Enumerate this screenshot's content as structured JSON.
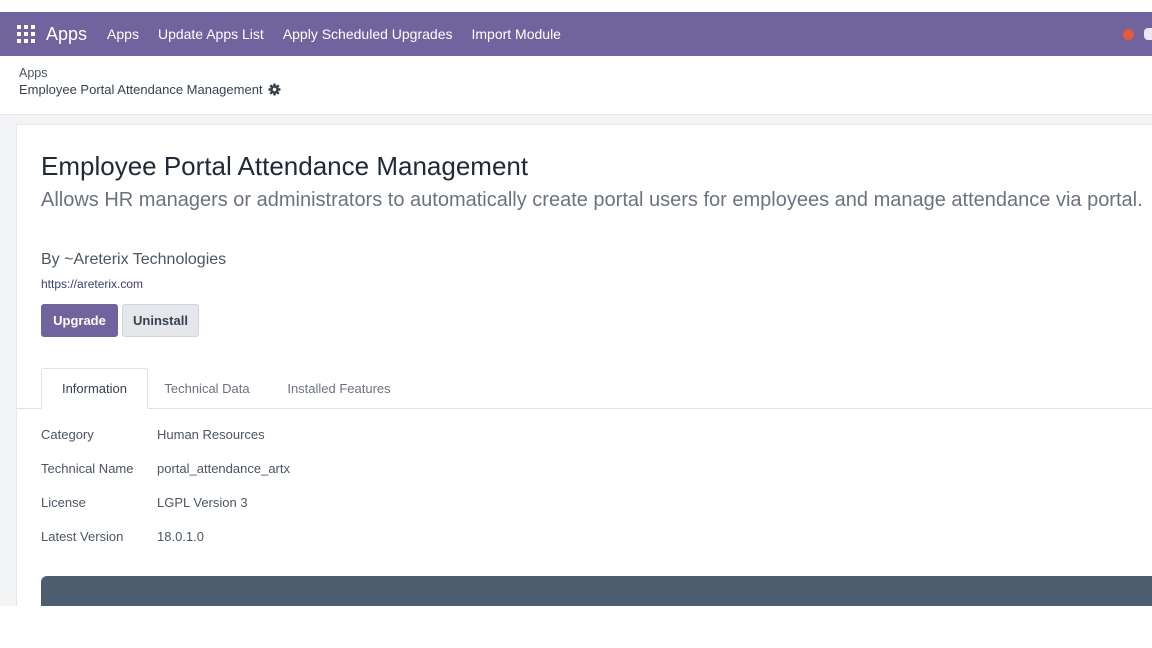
{
  "navbar": {
    "brand": "Apps",
    "menu": [
      "Apps",
      "Update Apps List",
      "Apply Scheduled Upgrades",
      "Import Module"
    ],
    "color": "#71639e",
    "icons": [
      "apps-grid-icon",
      "notification-dot-icon",
      "chat-icon"
    ]
  },
  "breadcrumb": {
    "parent": "Apps",
    "current": "Employee Portal Attendance Management",
    "icon": "gear-icon"
  },
  "module": {
    "title": "Employee Portal Attendance Management",
    "summary": "Allows HR managers or administrators to automatically create portal users for employees and manage attendance via portal.",
    "author": "By ~Areterix Technologies",
    "website": "https://areterix.com"
  },
  "buttons": {
    "upgrade": "Upgrade",
    "uninstall": "Uninstall"
  },
  "tabs": [
    {
      "label": "Information",
      "active": true
    },
    {
      "label": "Technical Data",
      "active": false
    },
    {
      "label": "Installed Features",
      "active": false
    }
  ],
  "fields": [
    {
      "label": "Category",
      "value": "Human Resources"
    },
    {
      "label": "Technical Name",
      "value": "portal_attendance_artx"
    },
    {
      "label": "License",
      "value": "LGPL Version 3"
    },
    {
      "label": "Latest Version",
      "value": "18.0.1.0"
    }
  ],
  "colors": {
    "accent": "#71639e",
    "banner": "#4b5d6e"
  }
}
